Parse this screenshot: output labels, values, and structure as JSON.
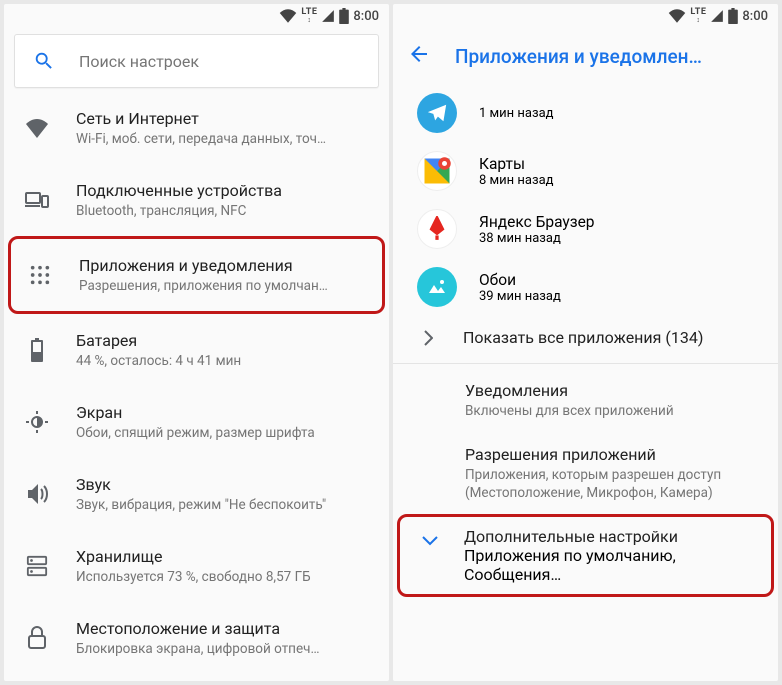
{
  "status": {
    "time": "8:00",
    "lte": "LTE"
  },
  "left": {
    "search_placeholder": "Поиск настроек",
    "items": [
      {
        "title": "Сеть и Интернет",
        "sub": "Wi-Fi, моб. сети, передача данных, точ…"
      },
      {
        "title": "Подключенные устройства",
        "sub": "Bluetooth, трансляция, NFC"
      },
      {
        "title": "Приложения и уведомления",
        "sub": "Разрешения, приложения по умолчан…"
      },
      {
        "title": "Батарея",
        "sub": "44 %, осталось: 4 ч 41 мин"
      },
      {
        "title": "Экран",
        "sub": "Обои, спящий режим, размер шрифта"
      },
      {
        "title": "Звук",
        "sub": "Звук, вибрация, режим \"Не беспокоить\""
      },
      {
        "title": "Хранилище",
        "sub": "Используется 73 %, свободно 8,57 ГБ"
      },
      {
        "title": "Местоположение и защита",
        "sub": "Блокировка экрана, цифровой отпеч…"
      }
    ]
  },
  "right": {
    "header": "Приложения и уведомлен…",
    "apps": [
      {
        "name": "",
        "sub": "1 мин назад"
      },
      {
        "name": "Карты",
        "sub": "8 мин назад"
      },
      {
        "name": "Яндекс Браузер",
        "sub": "38 мин назад"
      },
      {
        "name": "Обои",
        "sub": "39 мин назад"
      }
    ],
    "show_all": "Показать все приложения (134)",
    "sections": [
      {
        "title": "Уведомления",
        "sub": "Включены для всех приложений"
      },
      {
        "title": "Разрешения приложений",
        "sub": "Приложения, которым разрешен доступ (Местоположение, Микрофон, Камера)"
      }
    ],
    "expand": {
      "title": "Дополнительные настройки",
      "sub": "Приложения по умолчанию, Сообщения…"
    }
  }
}
